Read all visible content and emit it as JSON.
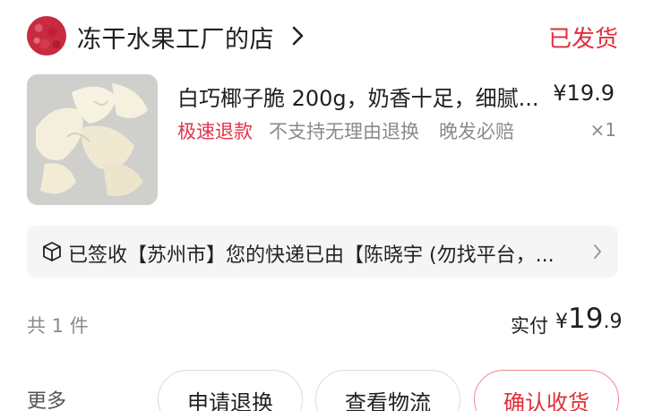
{
  "shop": {
    "name": "冻干水果工厂的店",
    "order_status": "已发货"
  },
  "product": {
    "title": "白巧椰子脆 200g，奶香十足，细腻...",
    "price": "¥19.9",
    "tags": {
      "fast_refund": "极速退款",
      "no_reason_return": "不支持无理由退换",
      "late_delivery": "晚发必赔"
    },
    "quantity": "×1"
  },
  "logistics": {
    "text": "已签收【苏州市】您的快递已由【陈晓宇 (勿找平台，..."
  },
  "summary": {
    "item_count": "共 1 件",
    "paid_label": "实付",
    "paid_currency": "¥",
    "paid_integer": "19",
    "paid_decimal": ".9"
  },
  "actions": {
    "more": "更多",
    "refund": "申请退换",
    "track": "查看物流",
    "confirm": "确认收货"
  },
  "colors": {
    "status_red": "#e02e3a",
    "tag_red": "#e0344a",
    "muted_gray": "#8a8a8a",
    "logistics_bg": "#f5f5f5"
  }
}
